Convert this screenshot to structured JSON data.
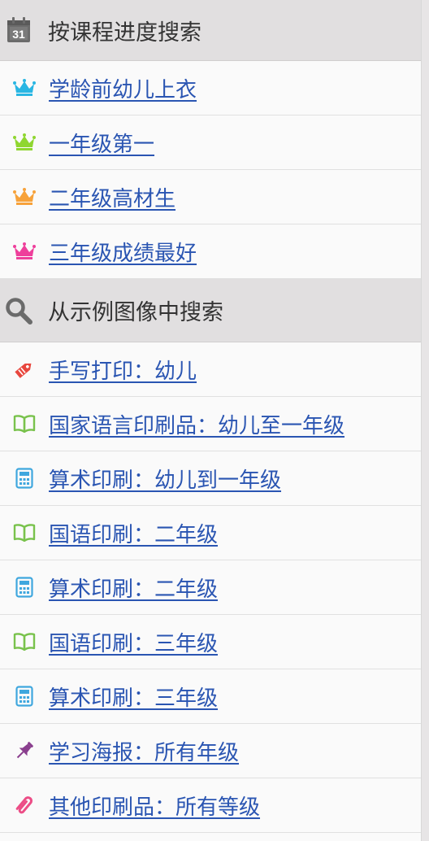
{
  "colors": {
    "link": "#2a55b2",
    "header_bg": "#e1dfe0",
    "crown_cyan": "#29b6e3",
    "crown_green": "#8fd630",
    "crown_orange": "#f7a23a",
    "crown_pink": "#ee3f9b",
    "book_green": "#79c24c",
    "calc_blue": "#3fa7de",
    "ticket_red": "#e8473e",
    "pin_purple": "#8a3f8e",
    "clip_pink": "#ec4d86"
  },
  "progress_section": {
    "icon": "calendar-icon",
    "calendar_day": "31",
    "title": "按课程进度搜索",
    "items": [
      {
        "icon": "crown-icon",
        "label": "学龄前幼儿上衣"
      },
      {
        "icon": "crown-icon",
        "label": "一年级第一"
      },
      {
        "icon": "crown-icon",
        "label": "二年级高材生"
      },
      {
        "icon": "crown-icon",
        "label": "三年级成绩最好"
      }
    ]
  },
  "example_section": {
    "icon": "search-icon",
    "title": "从示例图像中搜索",
    "items": [
      {
        "icon": "tag-icon",
        "label": "手写打印：幼儿"
      },
      {
        "icon": "book-icon",
        "label": "国家语言印刷品：幼儿至一年级"
      },
      {
        "icon": "calculator-icon",
        "label": "算术印刷：幼儿到一年级"
      },
      {
        "icon": "book-icon",
        "label": "国语印刷：二年级"
      },
      {
        "icon": "calculator-icon",
        "label": "算术印刷：二年级"
      },
      {
        "icon": "book-icon",
        "label": "国语印刷：三年级"
      },
      {
        "icon": "calculator-icon",
        "label": "算术印刷：三年级"
      },
      {
        "icon": "pin-icon",
        "label": "学习海报：所有年级"
      },
      {
        "icon": "paperclip-icon",
        "label": "其他印刷品：所有等级"
      }
    ]
  }
}
